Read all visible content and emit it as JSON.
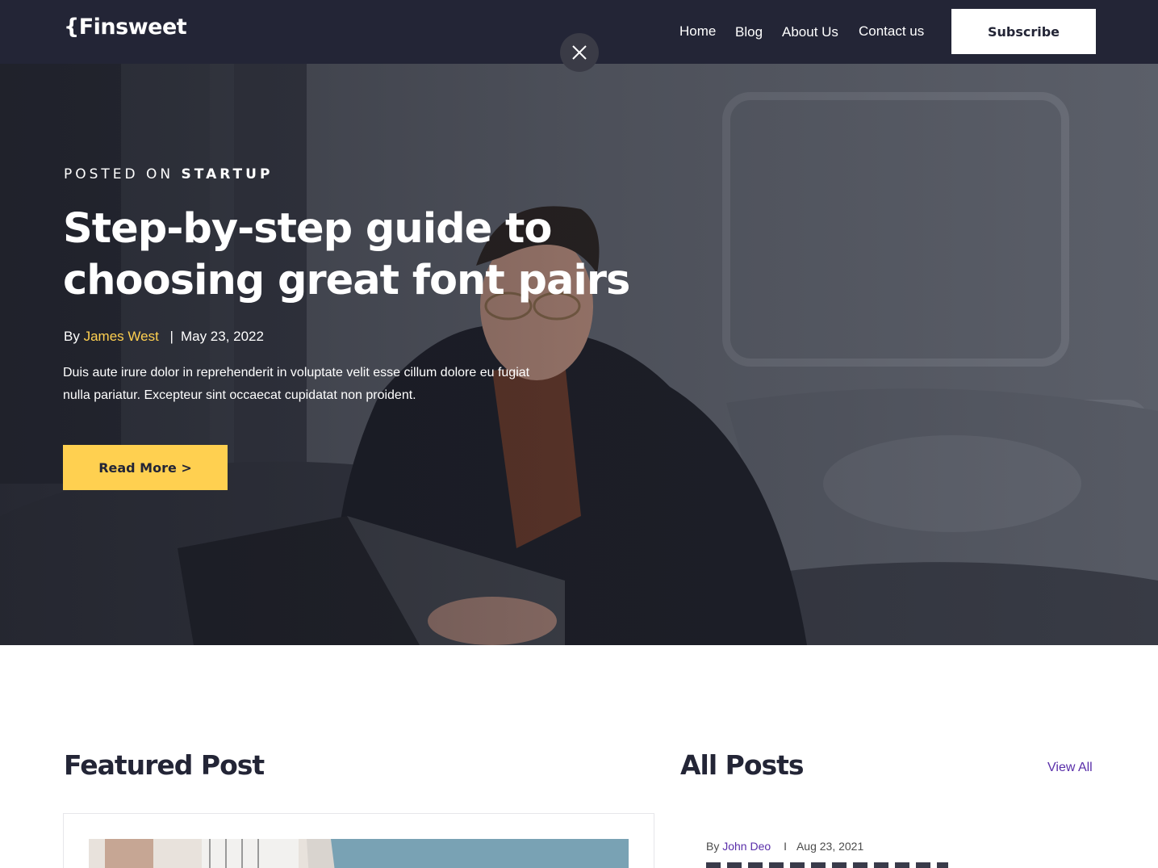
{
  "nav": {
    "logo": "{Finsweet",
    "links": [
      "Home",
      "Blog",
      "About Us",
      "Contact us"
    ],
    "subscribe_label": "Subscribe"
  },
  "overlay": {
    "close_icon": "close-icon"
  },
  "hero": {
    "posted_prefix": "POSTED ON",
    "posted_category": "STARTUP",
    "title": "Step-by-step guide to choosing great font pairs",
    "by": "By",
    "author": "James West",
    "separator": "|",
    "date": "May 23, 2022",
    "description": "Duis aute irure dolor in reprehenderit in voluptate velit esse cillum dolore eu fugiat nulla pariatur. Excepteur sint occaecat cupidatat non proident.",
    "read_more_label": "Read More >"
  },
  "featured": {
    "heading": "Featured Post"
  },
  "all_posts": {
    "heading": "All Posts",
    "view_all_label": "View All",
    "first_post": {
      "by": "By",
      "author": "John Deo",
      "separator": "I",
      "date": "Aug 23, 2021"
    }
  },
  "colors": {
    "navy": "#232536",
    "yellow": "#FFD050",
    "purple": "#592EA9",
    "white": "#FFFFFF"
  }
}
